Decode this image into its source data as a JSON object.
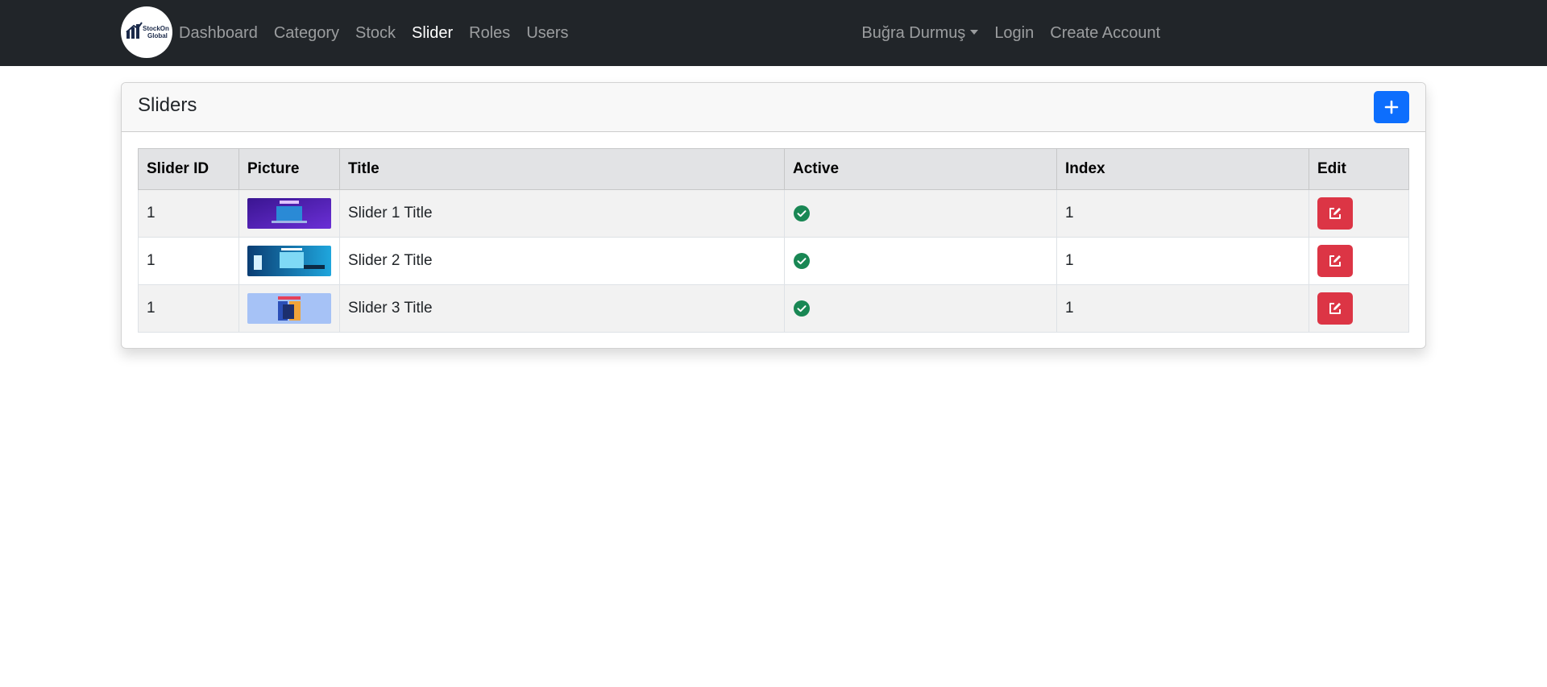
{
  "navbar": {
    "logo": {
      "line1": "StockOne",
      "line2": "Global"
    },
    "links": [
      {
        "label": "Dashboard",
        "active": false
      },
      {
        "label": "Category",
        "active": false
      },
      {
        "label": "Stock",
        "active": false
      },
      {
        "label": "Slider",
        "active": true
      },
      {
        "label": "Roles",
        "active": false
      },
      {
        "label": "Users",
        "active": false
      }
    ],
    "user_dropdown": "Buğra Durmuş",
    "login": "Login",
    "create_account": "Create Account"
  },
  "card": {
    "title": "Sliders",
    "add_icon": "plus-icon"
  },
  "table": {
    "headers": [
      "Slider ID",
      "Picture",
      "Title",
      "Active",
      "Index",
      "Edit"
    ],
    "rows": [
      {
        "id": "1",
        "title": "Slider 1 Title",
        "active": true,
        "index": "1",
        "thumb_colors": [
          "#4b1fa8",
          "#7c3ce0",
          "#2a8ad6"
        ]
      },
      {
        "id": "1",
        "title": "Slider 2 Title",
        "active": true,
        "index": "1",
        "thumb_colors": [
          "#0b4f8a",
          "#1e9ad6",
          "#53d2f0"
        ]
      },
      {
        "id": "1",
        "title": "Slider 3 Title",
        "active": true,
        "index": "1",
        "thumb_colors": [
          "#8fb3f2",
          "#a7c4f7",
          "#3a5fc9"
        ]
      }
    ]
  },
  "colors": {
    "navbar_bg": "#212529",
    "primary": "#0d6efd",
    "danger": "#dc3545",
    "success": "#198754"
  }
}
